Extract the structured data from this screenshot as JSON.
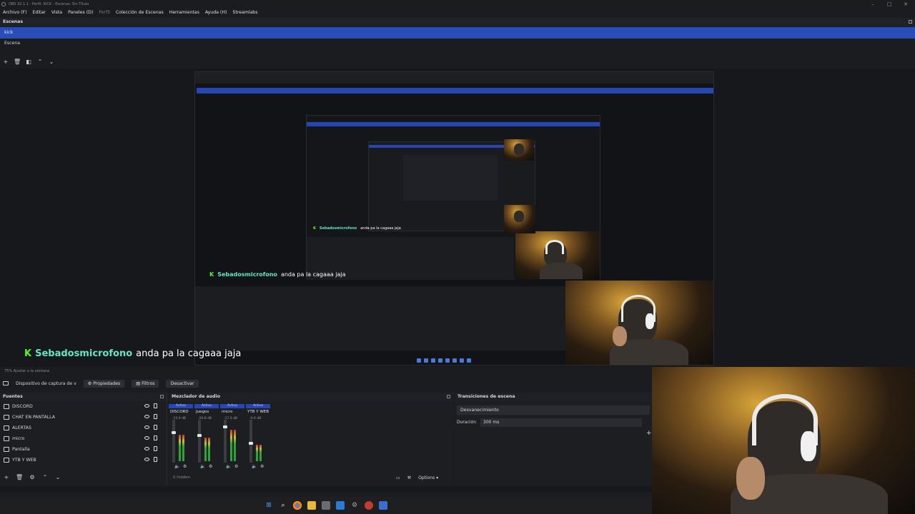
{
  "window": {
    "title": "OBS 32.1.1 - Perfil: KICK - Escenas: Sin Título",
    "controls": [
      "–",
      "□",
      "✕"
    ]
  },
  "menu": [
    {
      "label": "Archivo (F)",
      "disabled": false
    },
    {
      "label": "Editar",
      "disabled": false
    },
    {
      "label": "Vista",
      "disabled": false
    },
    {
      "label": "Paneles (D)",
      "disabled": false
    },
    {
      "label": "Perfil",
      "disabled": true
    },
    {
      "label": "Colección de Escenas",
      "disabled": false
    },
    {
      "label": "Herramientas",
      "disabled": false
    },
    {
      "label": "Ayuda (H)",
      "disabled": false
    },
    {
      "label": "Streamlabs",
      "disabled": false
    }
  ],
  "scenes": {
    "header": "Escenas",
    "items": [
      {
        "label": "kick",
        "selected": true
      },
      {
        "label": "Escena",
        "selected": false
      }
    ]
  },
  "chat": {
    "user": "Sebadosmicrofono",
    "message": "anda pa la cagaaa jaja",
    "platform_icon": "K"
  },
  "preview": {
    "zoom_text": "75%    Ajustar a la ventana"
  },
  "source_toolbar": {
    "source_name": "Dispositivo de captura de v",
    "properties": "Propiedades",
    "filters": "Filtros",
    "deactivate": "Desactivar"
  },
  "sources": {
    "header": "Fuentes",
    "items": [
      "DISCORD",
      "CHAT EN PANTALLA",
      "ALERTAS",
      "micro",
      "Pantalla",
      "YTB Y WEB"
    ]
  },
  "mixer": {
    "header": "Mezclador de audio",
    "active_label": "Activo",
    "channels": [
      {
        "name": "DISCORD",
        "db": "-15.9 dB",
        "level": 0.72
      },
      {
        "name": "Juegos",
        "db": "-20.8 dB",
        "level": 0.64
      },
      {
        "name": "micro",
        "db": "-17.0 dB",
        "level": 0.85
      },
      {
        "name": "YTB Y WEB",
        "db": "-9.6 dB",
        "level": 0.45
      }
    ],
    "hidden": "0 hidden",
    "options": "Options"
  },
  "transitions": {
    "header": "Transiciones de escena",
    "selected": "Desvanecimiento",
    "duration_label": "Duración",
    "duration_value": "300 ms"
  },
  "taskbar_icons": [
    "windows-start",
    "search",
    "chrome",
    "file-explorer",
    "calculator",
    "mail",
    "settings",
    "red-app",
    "shield-app"
  ]
}
